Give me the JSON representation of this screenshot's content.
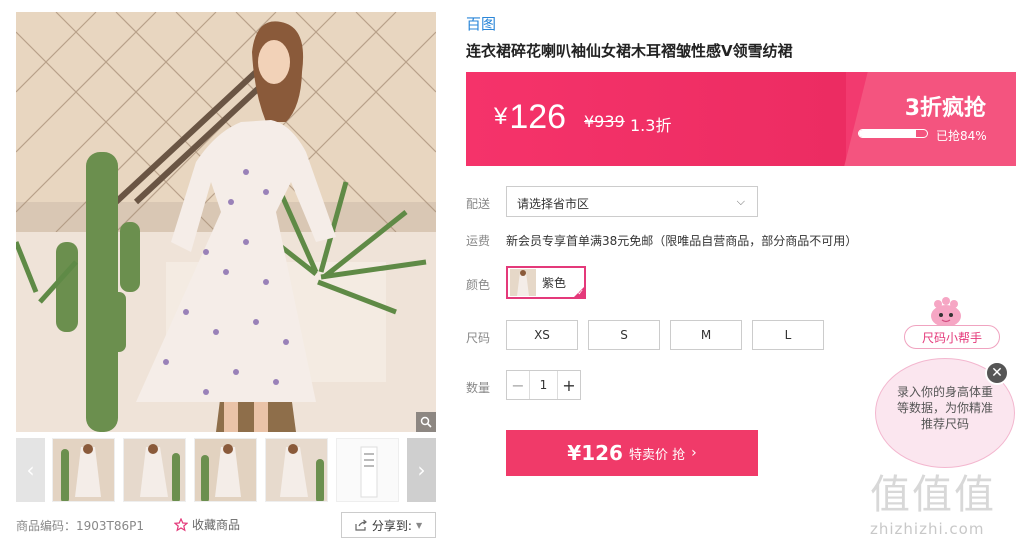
{
  "product": {
    "brand": "百图",
    "title": "连衣裙碎花喇叭袖仙女裙木耳褶皱性感V领雪纺裙",
    "sku_label": "商品编码：1903T86P1",
    "favorite_label": "收藏商品",
    "share_label": "分享到:"
  },
  "price": {
    "currency": "¥",
    "current": "126",
    "original": "¥939",
    "discount": "1.3折",
    "flash_title": "3折疯抢",
    "sold_text": "已抢84%",
    "sold_percent": 84
  },
  "form": {
    "delivery_label": "配送",
    "delivery_placeholder": "请选择省市区",
    "shipping_label": "运费",
    "shipping_text": "新会员专享首单满38元免邮（限唯品自营商品，部分商品不可用）",
    "color_label": "颜色",
    "color_value": "紫色",
    "size_label": "尺码",
    "sizes": [
      "XS",
      "S",
      "M",
      "L"
    ],
    "qty_label": "数量",
    "qty_value": "1",
    "qty_minus": "−",
    "qty_plus": "+"
  },
  "buy": {
    "price": "¥126",
    "label": "特卖价 抢"
  },
  "helper": {
    "tag": "尺码小帮手",
    "text": "录入你的身高体重等数据，为你精准推荐尺码",
    "close": "✕"
  },
  "watermark": {
    "logo": "值值值",
    "url": "zhizhizhi.com"
  },
  "icons": {
    "zoom": "magnifier-icon",
    "star": "star-icon",
    "share": "share-icon",
    "chevron": "chevron-down-icon",
    "buy_chevron": "chevron-right-icon",
    "close": "close-icon"
  },
  "colors": {
    "accent": "#f03a69",
    "brand_link": "#2a86d8",
    "selected": "#e4397a"
  }
}
